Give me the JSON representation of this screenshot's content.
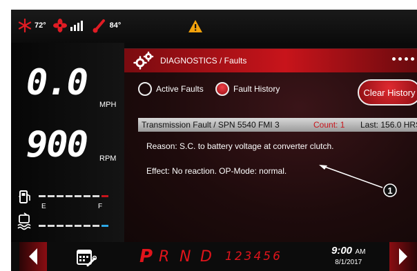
{
  "status": {
    "temp_inside": "72°",
    "temp_outside": "84°",
    "snowflake_color": "#e01c24",
    "icons": [
      "snowflake-icon",
      "fan-icon",
      "signal-bars-icon",
      "thermometer-icon",
      "warning-icon"
    ]
  },
  "gauges": {
    "speed_value": "0.0",
    "speed_unit": "MPH",
    "rpm_value": "900",
    "rpm_unit": "RPM",
    "fuel_empty_label": "E",
    "fuel_full_label": "F",
    "fuel_icon": "fuel-pump-icon",
    "def_icon": "def-fluid-icon"
  },
  "diagnostics": {
    "title": "DIAGNOSTICS / Faults",
    "tab_active": "Active Faults",
    "tab_history": "Fault History",
    "clear_button": "Clear History",
    "fault": {
      "name": "Transmission Fault / SPN 5540 FMI 3",
      "count": "Count: 1",
      "last": "Last: 156.0 HRS",
      "reason": "Reason: S.C. to battery voltage at converter clutch.",
      "effect": "Effect: No reaction. OP-Mode: normal."
    },
    "callout": "1"
  },
  "bottom": {
    "gears": [
      "P",
      "R",
      "N",
      "D"
    ],
    "gear_numbers": "123456",
    "time": "9:00",
    "ampm": "AM",
    "date": "8/1/2017",
    "accent": "#e0141b"
  }
}
